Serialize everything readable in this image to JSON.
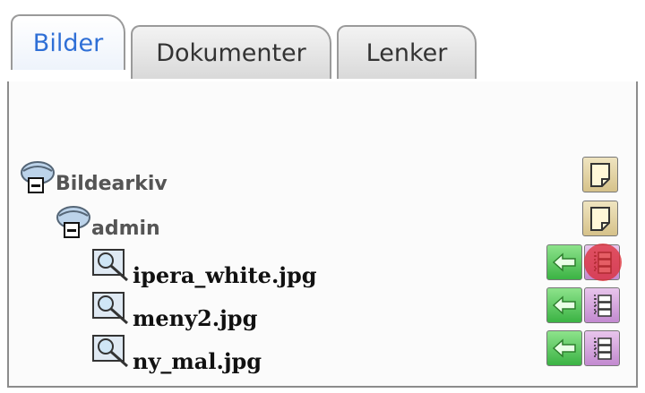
{
  "tabs": [
    {
      "label": "Bilder",
      "active": true
    },
    {
      "label": "Dokumenter",
      "active": false
    },
    {
      "label": "Lenker",
      "active": false
    }
  ],
  "toolbar": {
    "home_icon": "home-icon",
    "tree_icon": "tree-view-icon"
  },
  "tree": {
    "root": {
      "label": "Bildearkiv"
    },
    "folder": {
      "label": "admin"
    },
    "files": [
      {
        "label": "ipera_white.jpg"
      },
      {
        "label": "meny2.jpg"
      },
      {
        "label": "ny_mal.jpg"
      }
    ]
  },
  "colors": {
    "active_tab_text": "#2f6fd6",
    "select_button": "#4fbf4f",
    "properties_button": "#d39fdc",
    "new_button": "#e2cf98",
    "highlight": "#dc2832"
  }
}
